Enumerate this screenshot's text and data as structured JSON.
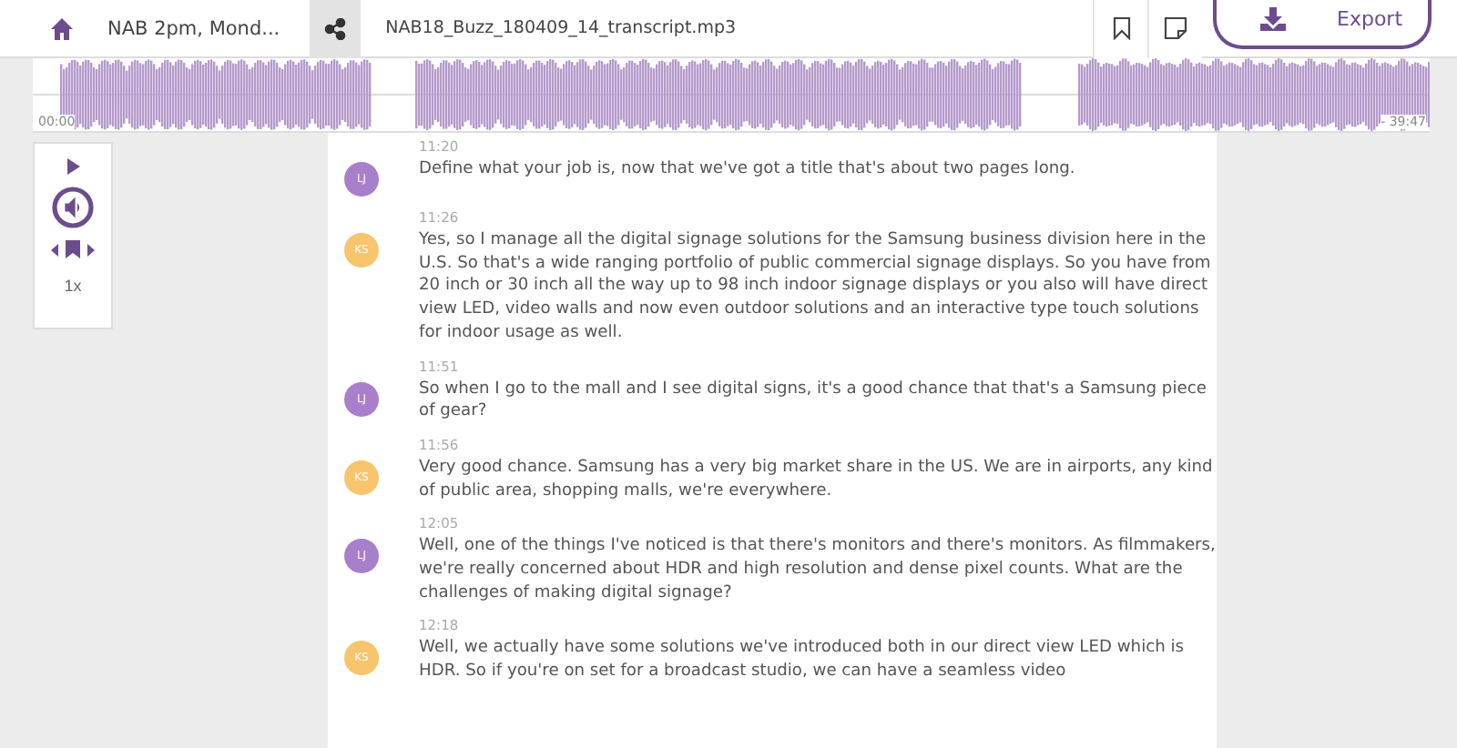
{
  "toolbar": {
    "title": "NAB 2pm, Mond...",
    "filename": "NAB18_Buzz_180409_14_transcript.mp3",
    "export_label": "Export"
  },
  "waveform": {
    "start_time": "00:00",
    "end_time": "- 39:47"
  },
  "player": {
    "speed": "1x"
  },
  "transcript": [
    {
      "initials": "LJ",
      "color": "#a87fca",
      "time": "11:20",
      "text": "Define what your job is, now that we've got a title that's about two pages long."
    },
    {
      "initials": "KS",
      "color": "#f8c46c",
      "time": "11:26",
      "text": "Yes, so I manage all the digital signage solutions for the Samsung business division here in the U.S. So that's a wide ranging portfolio of public commercial signage displays. So you have from 20 inch or 30 inch all the way up to 98 inch indoor signage displays or you also will have direct view LED, video walls and now even outdoor solutions and an interactive type touch solutions for indoor usage as well."
    },
    {
      "initials": "LJ",
      "color": "#a87fca",
      "time": "11:51",
      "text": "So when I go to the mall and I see digital signs, it's a good chance that that's a Samsung piece of gear?"
    },
    {
      "initials": "KS",
      "color": "#f8c46c",
      "time": "11:56",
      "text": "Very good chance. Samsung has a very big market share in the US. We are in airports, any kind of public area, shopping malls, we're everywhere."
    },
    {
      "initials": "LJ",
      "color": "#a87fca",
      "time": "12:05",
      "text": "Well, one of the things I've noticed is that there's monitors and there's monitors. As filmmakers, we're really concerned about HDR and high resolution and dense pixel counts. What are the challenges of making digital signage?"
    },
    {
      "initials": "KS",
      "color": "#f8c46c",
      "time": "12:18",
      "text": "Well, we actually have some solutions we've introduced both in our direct view LED which is HDR. So if you're on set for a broadcast studio, we can have a seamless video"
    }
  ]
}
